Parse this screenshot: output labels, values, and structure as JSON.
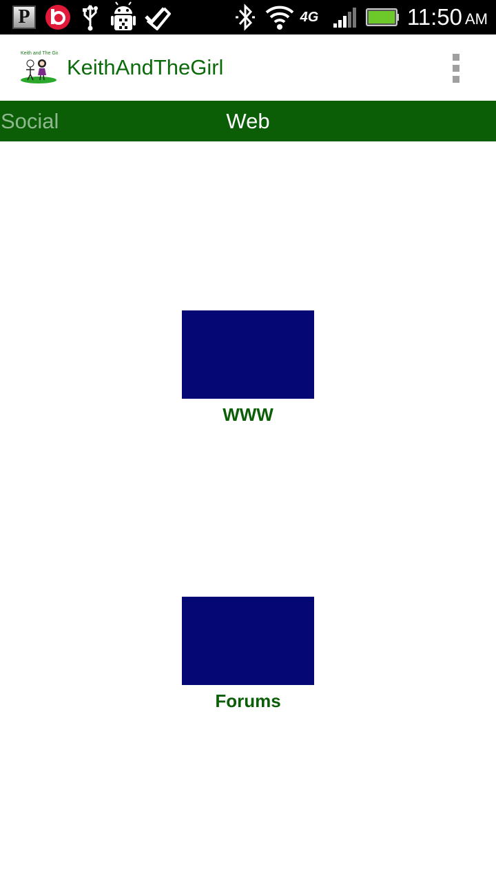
{
  "status_bar": {
    "time": "11:50",
    "ampm": "AM",
    "network": "4G",
    "icons": [
      "pandora-icon",
      "beats-icon",
      "usb-icon",
      "android-debug-icon",
      "task-check-icon",
      "bluetooth-icon",
      "wifi-icon",
      "signal-icon",
      "battery-icon"
    ]
  },
  "action_bar": {
    "logo_text": "Keith and The Girl",
    "title": "KeithAndTheGirl",
    "overflow_icon": "overflow-menu-icon"
  },
  "tabs": [
    {
      "label": "Social",
      "active": false
    },
    {
      "label": "Web",
      "active": true
    }
  ],
  "links": [
    {
      "label": "WWW"
    },
    {
      "label": "Forums"
    }
  ],
  "colors": {
    "brand_green": "#0b5d06",
    "title_green": "#0b6b0b",
    "thumb_blue": "#050774",
    "inactive_tab": "#8fb88f"
  }
}
